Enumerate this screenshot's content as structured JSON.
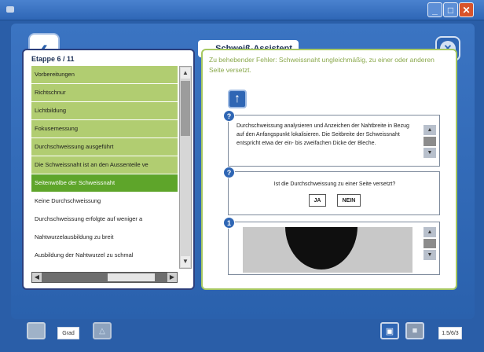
{
  "window": {
    "minimize_icon": "minimize-icon",
    "maximize_icon": "maximize-icon",
    "close_icon": "close-icon"
  },
  "header": {
    "title": "→ Schweiß-Assistent",
    "back_icon": "chevron-left-icon",
    "close_icon": "close-circle-icon"
  },
  "sidebar": {
    "stage_label": "Etappe 6 / 11",
    "items": [
      {
        "label": "Vorbereitungen",
        "state": "done"
      },
      {
        "label": "Richtschnur",
        "state": "done"
      },
      {
        "label": "Lichtbildung",
        "state": "done"
      },
      {
        "label": "Fokusemessung",
        "state": "done"
      },
      {
        "label": "Durchschweissung ausgeführt",
        "state": "done"
      },
      {
        "label": "Die Schweissnaht ist an den Aussenteile ve",
        "state": "done"
      },
      {
        "label": "Seitenwölbe der Schweissnaht",
        "state": "active"
      },
      {
        "label": "Keine Durchschweissung",
        "state": "pending"
      },
      {
        "label": "Durchschweissung erfolgte auf weniger a",
        "state": "pending"
      },
      {
        "label": "Nahtwurzelausbildung zu breit",
        "state": "pending"
      },
      {
        "label": "Ausbildung der Nahtwurzel zu schmal",
        "state": "pending"
      }
    ]
  },
  "content": {
    "error_description": "Zu behebender Fehler: Schweissnaht ungleichmäßig, zu einer oder anderen Seite versetzt.",
    "up_icon": "arrow-up-icon",
    "instruction": "Durchschweissung analysieren und Anzeichen der Nahtbreite in Bezug auf den Anfangspunkt lokalisieren. Die Seitbreite der Schweissnaht entspricht etwa der ein- bis zweifachen Dicke der Bleche.",
    "question": "Ist die Durchschweissung zu einer Seite versetzt?",
    "yes_label": "JA",
    "no_label": "NEIN",
    "badges": [
      "?",
      "?",
      "1"
    ]
  },
  "footer": {
    "text_button_label": "Grad",
    "info_label": "1.5/6/3",
    "monitor_icon": "monitor-icon",
    "shapes_icon": "shapes-icon",
    "save_icon": "save-icon",
    "lock_icon": "lock-icon"
  }
}
